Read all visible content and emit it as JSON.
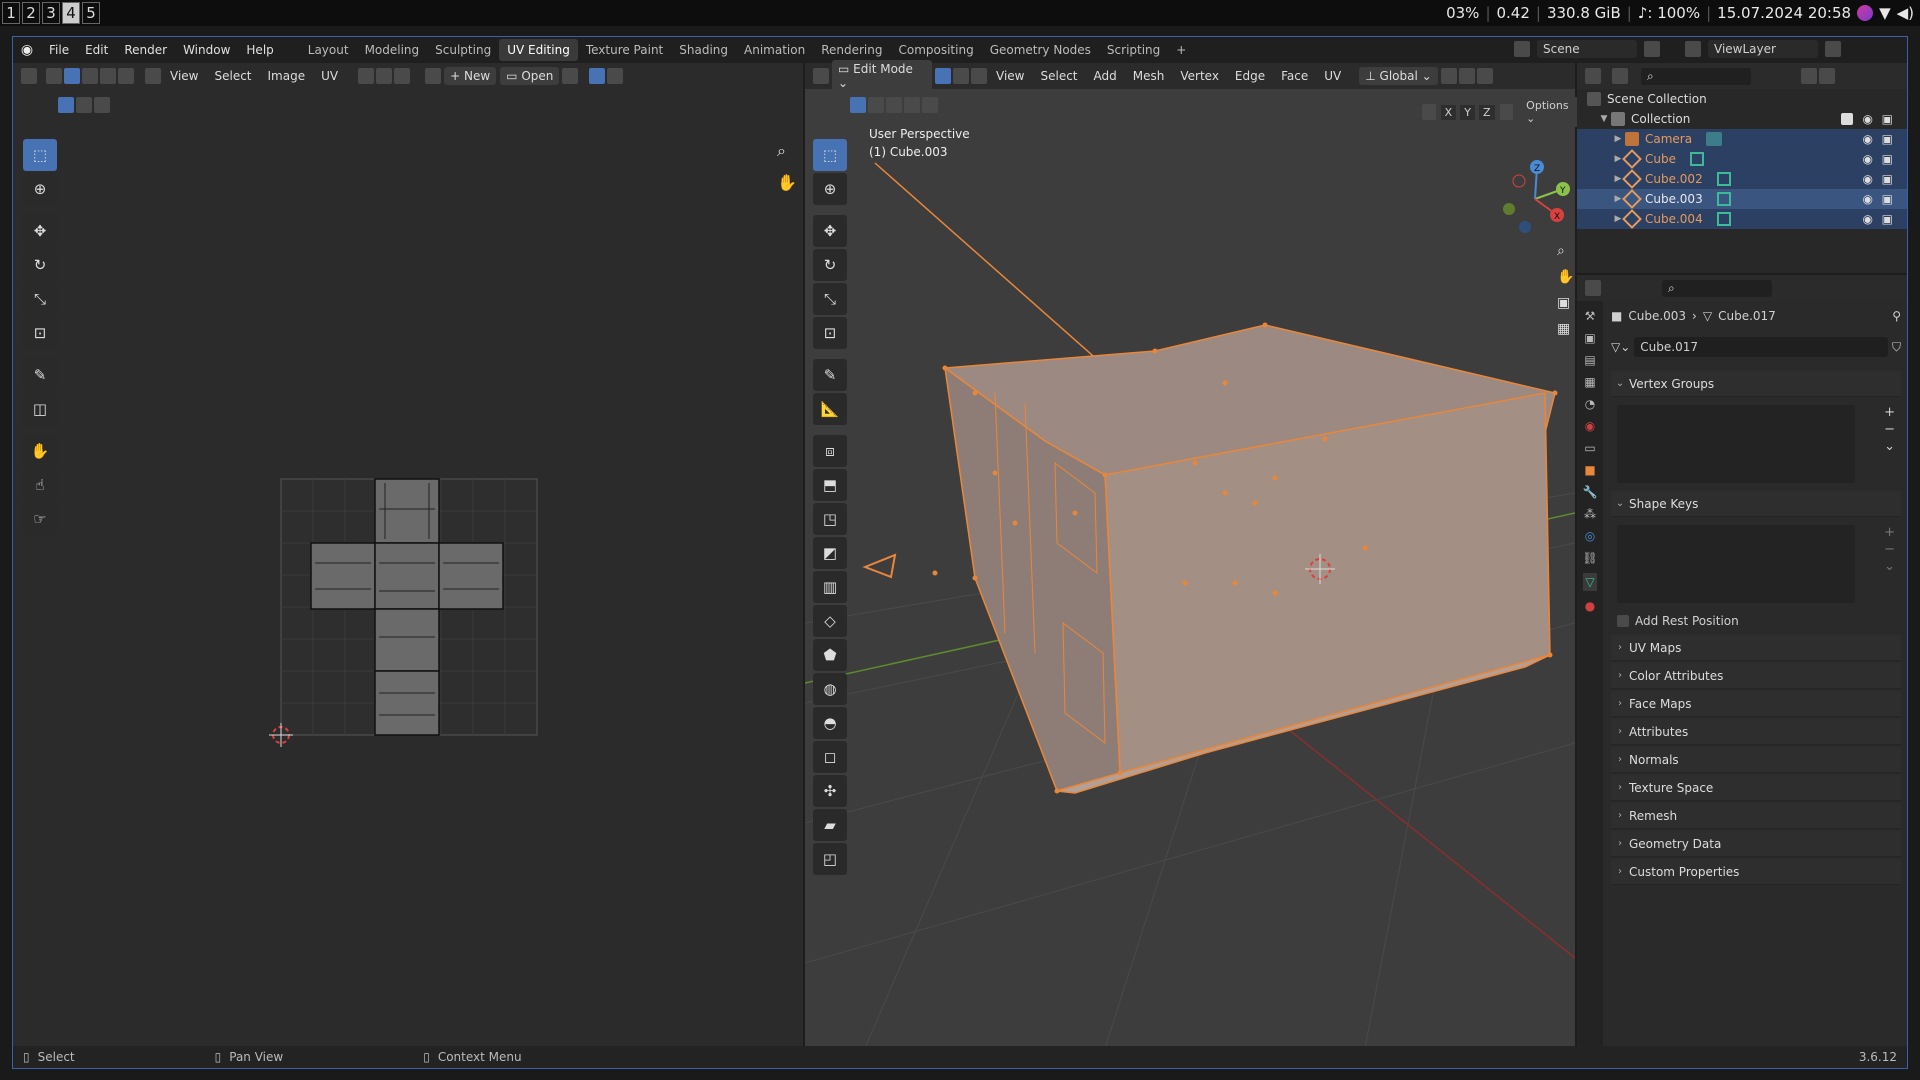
{
  "sysbar": {
    "workspaces": [
      "1",
      "2",
      "3",
      "4",
      "5"
    ],
    "active_workspace": "4",
    "cpu": "03%",
    "load": "0.42",
    "disk": "330.8 GiB",
    "volume": "♪: 100%",
    "datetime": "15.07.2024 20:58"
  },
  "topbar": {
    "menus": [
      "File",
      "Edit",
      "Render",
      "Window",
      "Help"
    ],
    "tabs": [
      "Layout",
      "Modeling",
      "Sculpting",
      "UV Editing",
      "Texture Paint",
      "Shading",
      "Animation",
      "Rendering",
      "Compositing",
      "Geometry Nodes",
      "Scripting"
    ],
    "active_tab": "UV Editing",
    "add_tab": "+",
    "scene": "Scene",
    "view_layer": "ViewLayer"
  },
  "uv_editor": {
    "menus": [
      "View",
      "Select",
      "Image",
      "UV"
    ],
    "new_label": "New",
    "open_label": "Open"
  },
  "viewport": {
    "mode": "Edit Mode",
    "menus": [
      "View",
      "Select",
      "Add",
      "Mesh",
      "Vertex",
      "Edge",
      "Face",
      "UV"
    ],
    "orientation": "Global",
    "options": "Options",
    "axes": [
      "X",
      "Y",
      "Z"
    ],
    "overlay_line1": "User Perspective",
    "overlay_line2": "(1) Cube.003",
    "gizmo": {
      "x": "X",
      "y": "Y",
      "z": "Z"
    }
  },
  "outliner": {
    "root": "Scene Collection",
    "collection": "Collection",
    "items": [
      {
        "name": "Camera",
        "color": "#e59a5a"
      },
      {
        "name": "Cube",
        "color": "#e59a5a"
      },
      {
        "name": "Cube.002",
        "color": "#e59a5a"
      },
      {
        "name": "Cube.003",
        "color": "#e8e8e8"
      },
      {
        "name": "Cube.004",
        "color": "#e59a5a"
      }
    ]
  },
  "properties": {
    "breadcrumb_object": "Cube.003",
    "breadcrumb_mesh": "Cube.017",
    "mesh_name": "Cube.017",
    "vertex_groups": "Vertex Groups",
    "shape_keys": "Shape Keys",
    "add_rest_position": "Add Rest Position",
    "sections": [
      "UV Maps",
      "Color Attributes",
      "Face Maps",
      "Attributes",
      "Normals",
      "Texture Space",
      "Remesh",
      "Geometry Data",
      "Custom Properties"
    ]
  },
  "statusbar": {
    "select": "Select",
    "pan": "Pan View",
    "context": "Context Menu",
    "version": "3.6.12"
  },
  "colors": {
    "accent": "#4772b3",
    "selection": "#e8873a",
    "mesh": "#a48f85"
  }
}
